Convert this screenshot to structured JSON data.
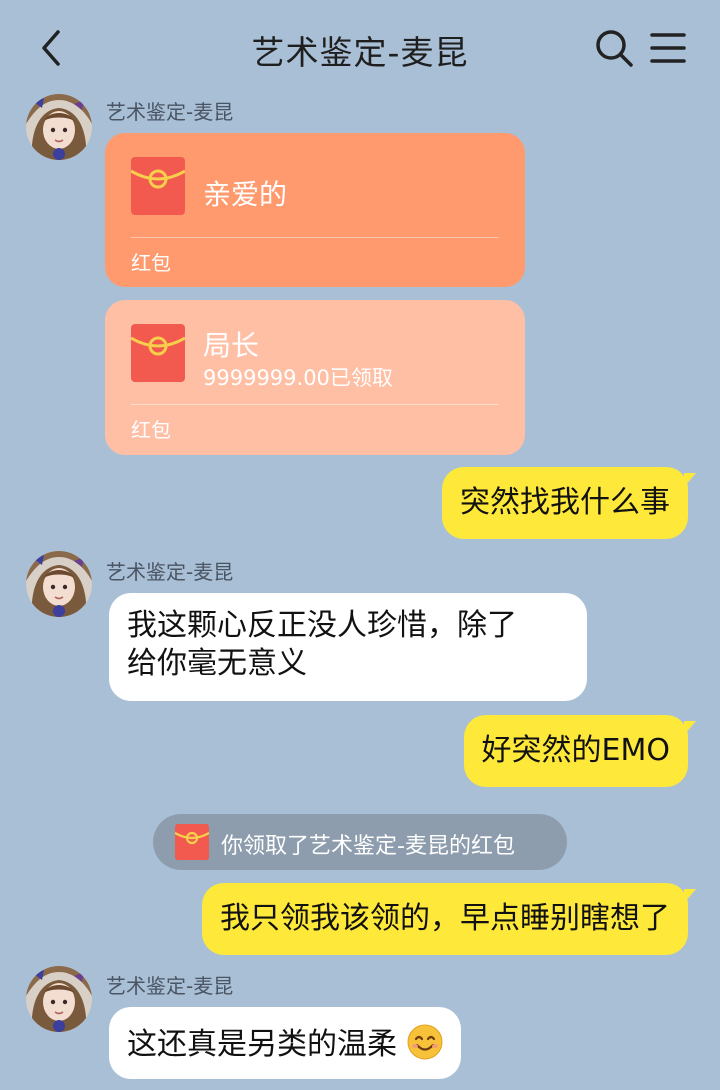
{
  "header": {
    "title": "艺术鉴定-麦昆"
  },
  "colors": {
    "background": "#a9bfd6",
    "my_bubble": "#fee93a",
    "their_bubble": "#ffffff",
    "redpacket_unopened": "#ff9a6e",
    "redpacket_opened": "#ffbfa5",
    "packet_red": "#f25a4f",
    "packet_gold": "#f7cf4c"
  },
  "messages": [
    {
      "sender": "艺术鉴定-麦昆",
      "type": "redpacket",
      "title": "亲爱的",
      "subtitle": "",
      "label": "红包",
      "opened": false
    },
    {
      "type": "redpacket",
      "title": "局长",
      "subtitle": "9999999.00已领取",
      "label": "红包",
      "opened": true
    },
    {
      "from": "me",
      "text": "突然找我什么事"
    },
    {
      "sender": "艺术鉴定-麦昆",
      "from": "them",
      "text_line1": "我这颗心反正没人珍惜，除了",
      "text_line2": "给你毫无意义"
    },
    {
      "from": "me",
      "text": "好突然的EMO"
    },
    {
      "type": "notice",
      "text": "你领取了艺术鉴定-麦昆的红包"
    },
    {
      "from": "me",
      "text": "我只领我该领的，早点睡别瞎想了"
    },
    {
      "sender": "艺术鉴定-麦昆",
      "from": "them",
      "text": "这还真是另类的温柔",
      "emoji": "smiling-face"
    }
  ]
}
